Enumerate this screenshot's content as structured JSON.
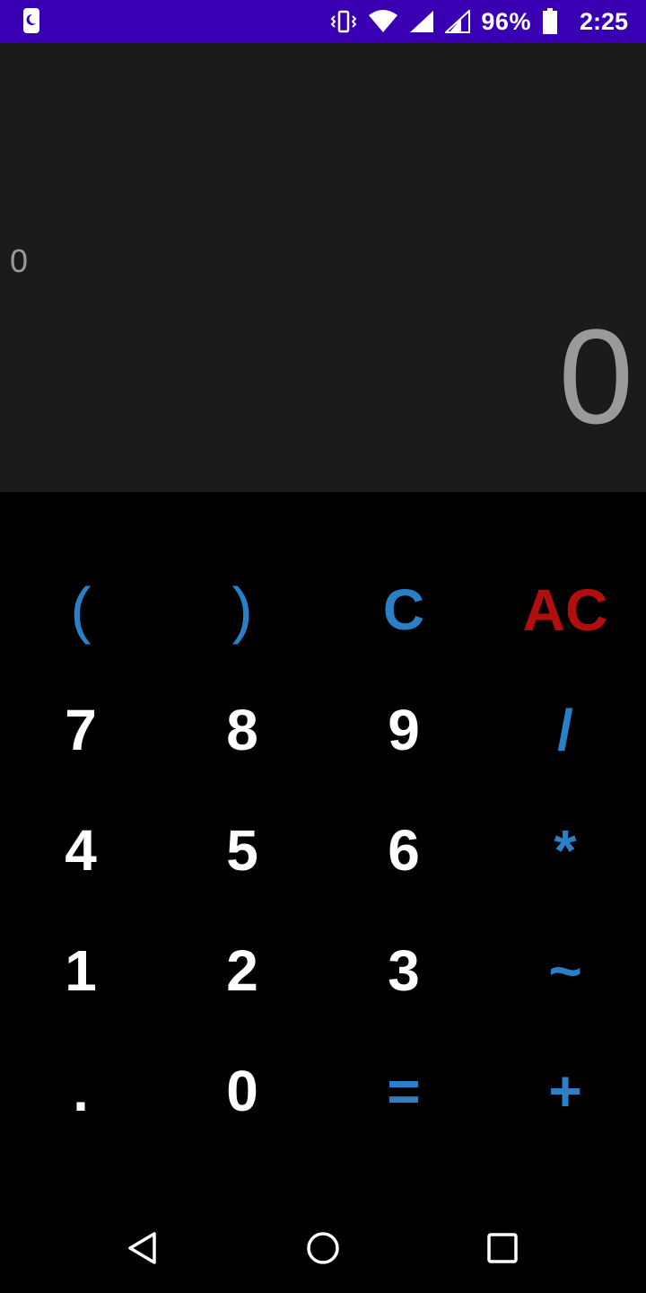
{
  "status_bar": {
    "battery_percent": "96%",
    "time": "2:25",
    "icons": [
      "app-notification-icon",
      "vibrate-icon",
      "wifi-icon",
      "signal-icon",
      "signal-icon",
      "battery-icon"
    ],
    "background_color": "#3900b3"
  },
  "display": {
    "expression": "0",
    "result": "0"
  },
  "keypad": {
    "row1": [
      "(",
      ")",
      "C",
      "AC"
    ],
    "row2": [
      "7",
      "8",
      "9",
      "/"
    ],
    "row3": [
      "4",
      "5",
      "6",
      "*"
    ],
    "row4": [
      "1",
      "2",
      "3",
      "~"
    ],
    "row5": [
      ".",
      "0",
      "=",
      "+"
    ]
  },
  "colors": {
    "operator": "#2a80c6",
    "clear_all": "#b20e0e",
    "digit": "#ffffff",
    "display_text": "#9a9a9a",
    "display_bg": "#1b1b1b",
    "keypad_bg": "#000000"
  },
  "nav_bar": {
    "icons": [
      "back-icon",
      "home-icon",
      "recents-icon"
    ]
  }
}
